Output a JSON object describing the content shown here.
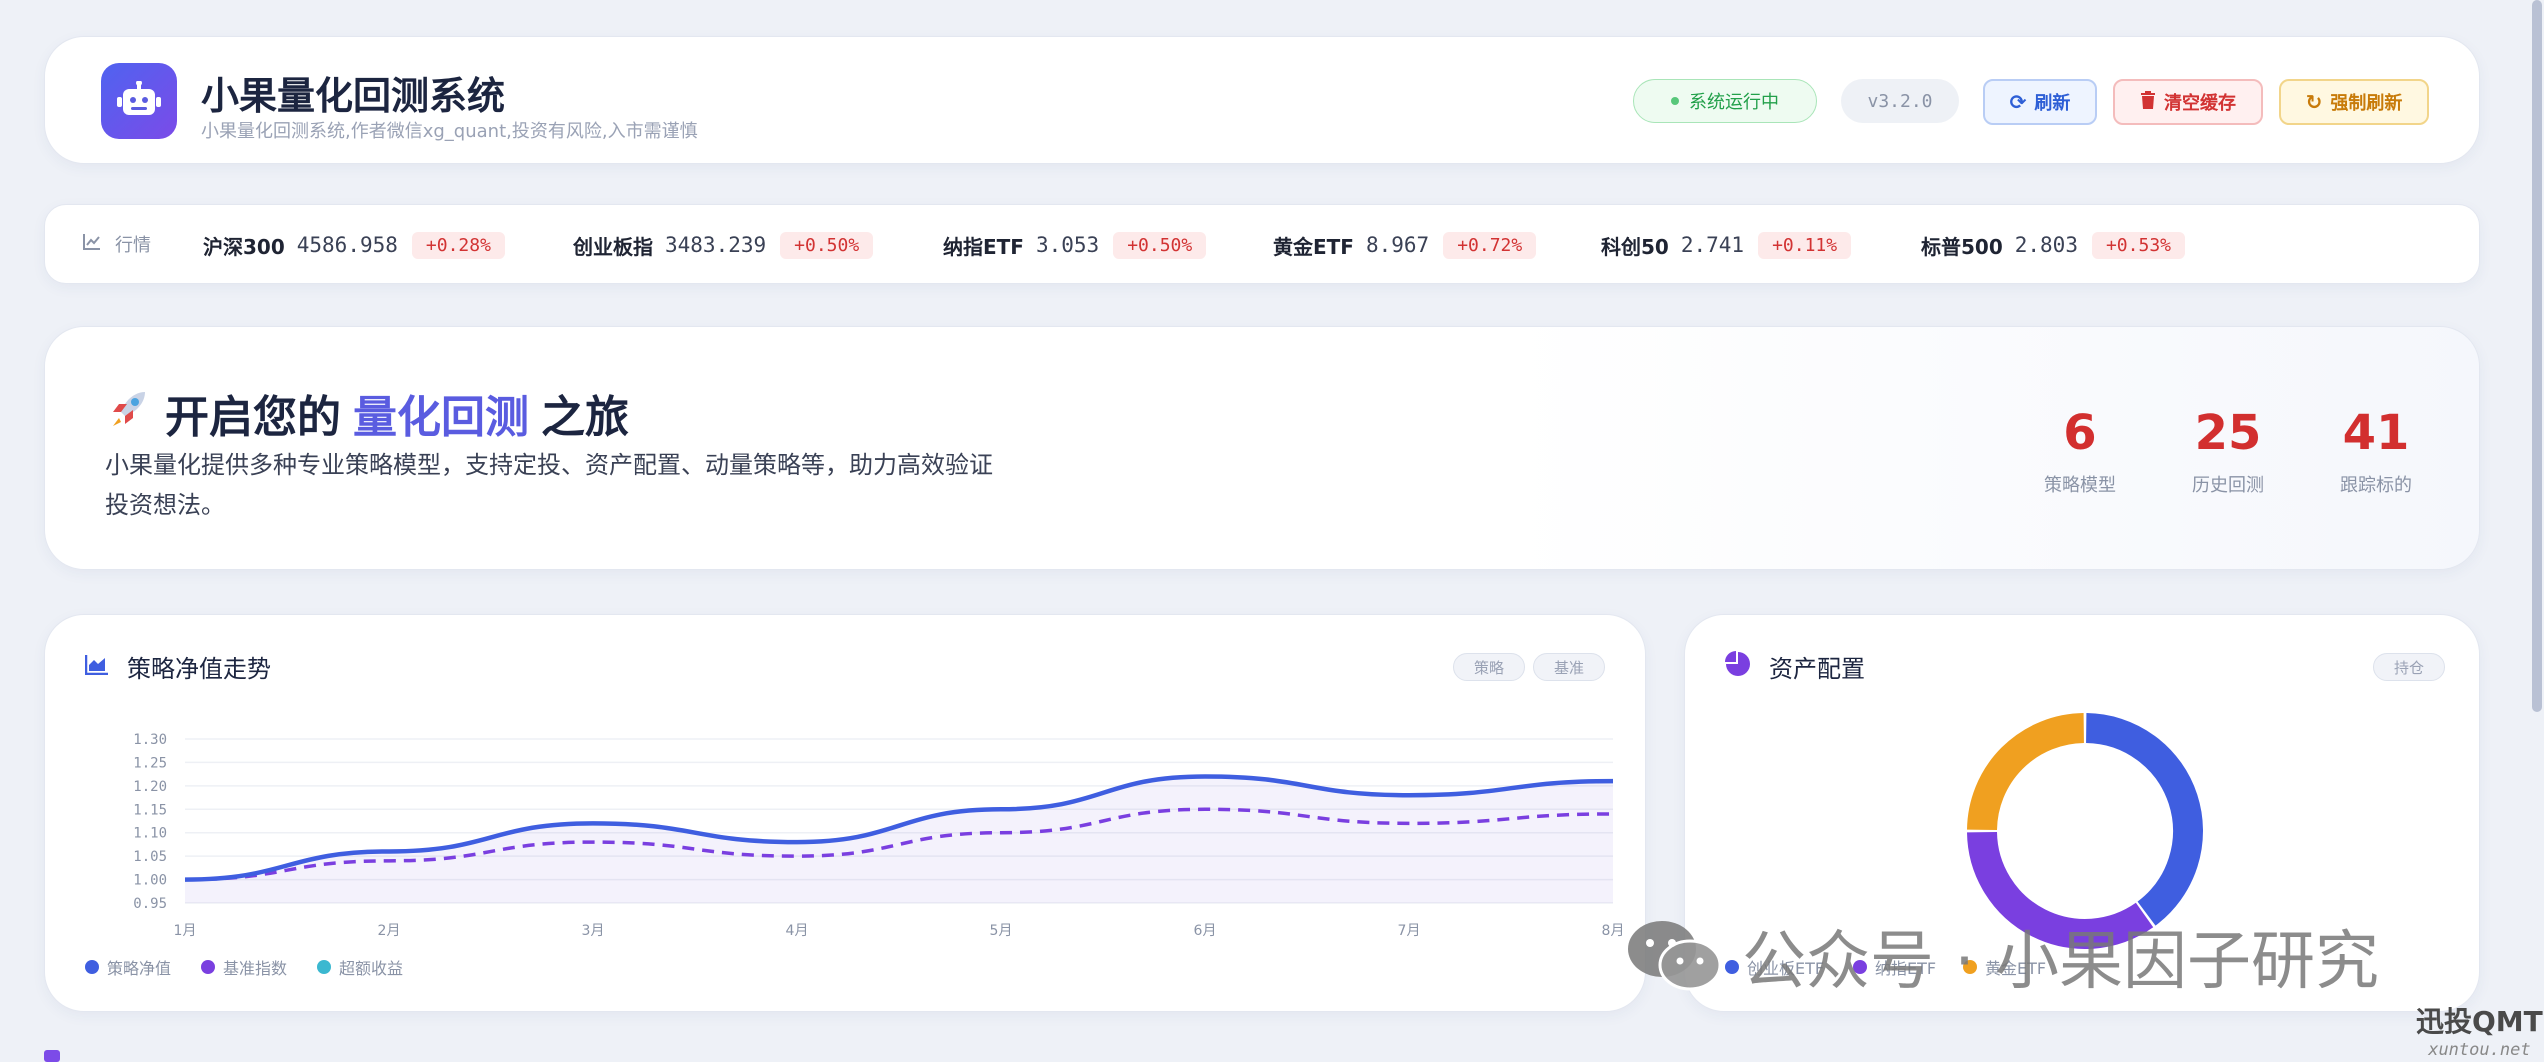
{
  "header": {
    "title": "小果量化回测系统",
    "subtitle": "小果量化回测系统,作者微信xg_quant,投资有风险,入市需谨慎",
    "status": "系统运行中",
    "version": "v3.2.0",
    "refresh_label": "刷新",
    "clear_label": "清空缓存",
    "force_label": "强制刷新"
  },
  "ticker": {
    "label": "行情",
    "items": [
      {
        "name": "沪深300",
        "price": "4586.958",
        "change": "+0.28%"
      },
      {
        "name": "创业板指",
        "price": "3483.239",
        "change": "+0.50%"
      },
      {
        "name": "纳指ETF",
        "price": "3.053",
        "change": "+0.50%"
      },
      {
        "name": "黄金ETF",
        "price": "8.967",
        "change": "+0.72%"
      },
      {
        "name": "科创50",
        "price": "2.741",
        "change": "+0.11%"
      },
      {
        "name": "标普500",
        "price": "2.803",
        "change": "+0.53%"
      }
    ]
  },
  "hero": {
    "title_prefix": "开启您的",
    "title_highlight": "量化回测",
    "title_suffix": "之旅",
    "description": "小果量化提供多种专业策略模型，支持定投、资产配置、动量策略等，助力高效验证投资想法。",
    "stats": [
      {
        "value": "6",
        "label": "策略模型"
      },
      {
        "value": "25",
        "label": "历史回测"
      },
      {
        "value": "41",
        "label": "跟踪标的"
      }
    ]
  },
  "nav_chart": {
    "title": "策略净值走势",
    "chips": [
      "策略",
      "基准"
    ],
    "legend": [
      "策略净值",
      "基准指数",
      "超额收益"
    ]
  },
  "alloc_chart": {
    "title": "资产配置",
    "chip": "持仓",
    "legend": [
      "创业板ETF",
      "纳指ETF",
      "黄金ETF"
    ]
  },
  "watermark": {
    "text": "公众号 · 小果因子研究",
    "corner_big": "迅投QMT",
    "corner_small": "xuntou.net"
  },
  "colors": {
    "strategy": "#3f5ee0",
    "benchmark": "#7a3fe0",
    "excess": "#3bb8d0",
    "gold": "#f0a020",
    "up": "#d23333"
  },
  "chart_data": [
    {
      "type": "line",
      "title": "策略净值走势",
      "categories": [
        "1月",
        "2月",
        "3月",
        "4月",
        "5月",
        "6月",
        "7月",
        "8月"
      ],
      "series": [
        {
          "name": "策略净值",
          "values": [
            1.0,
            1.06,
            1.12,
            1.08,
            1.15,
            1.22,
            1.18,
            1.21
          ]
        },
        {
          "name": "基准指数",
          "values": [
            1.0,
            1.04,
            1.08,
            1.05,
            1.1,
            1.15,
            1.12,
            1.14
          ]
        }
      ],
      "yticks": [
        "1.30",
        "1.25",
        "1.20",
        "1.15",
        "1.10",
        "1.05",
        "1.00",
        "0.95"
      ],
      "ylim": [
        0.95,
        1.3
      ],
      "grid": true
    },
    {
      "type": "pie",
      "title": "资产配置",
      "categories": [
        "创业板ETF",
        "纳指ETF",
        "黄金ETF"
      ],
      "values": [
        40,
        35,
        25
      ]
    }
  ]
}
